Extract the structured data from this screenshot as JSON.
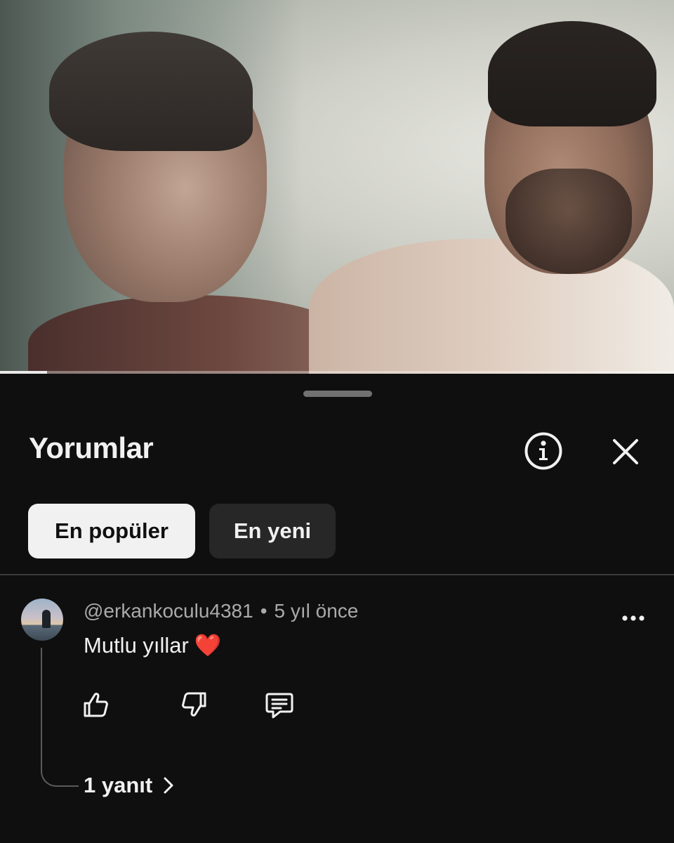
{
  "video": {
    "progress": 0.07
  },
  "comments_panel": {
    "title": "Yorumlar",
    "info_icon": "info-circle-icon",
    "close_icon": "close-icon",
    "sort_chips": [
      {
        "label": "En popüler",
        "selected": true
      },
      {
        "label": "En yeni",
        "selected": false
      }
    ]
  },
  "comments": [
    {
      "author": "@erkankoculu4381",
      "separator": "•",
      "time": "5 yıl önce",
      "text": "Mutlu yıllar",
      "emoji": "❤️",
      "actions": [
        "thumbs-up-icon",
        "thumbs-down-icon",
        "comment-reply-icon"
      ],
      "replies_label": "1 yanıt"
    }
  ],
  "colors": {
    "background": "#0f0f0f",
    "chip_selected_bg": "#f1f1f1",
    "chip_bg": "#272727",
    "secondary_text": "#aaaaaa",
    "heart": "#e0242f"
  }
}
